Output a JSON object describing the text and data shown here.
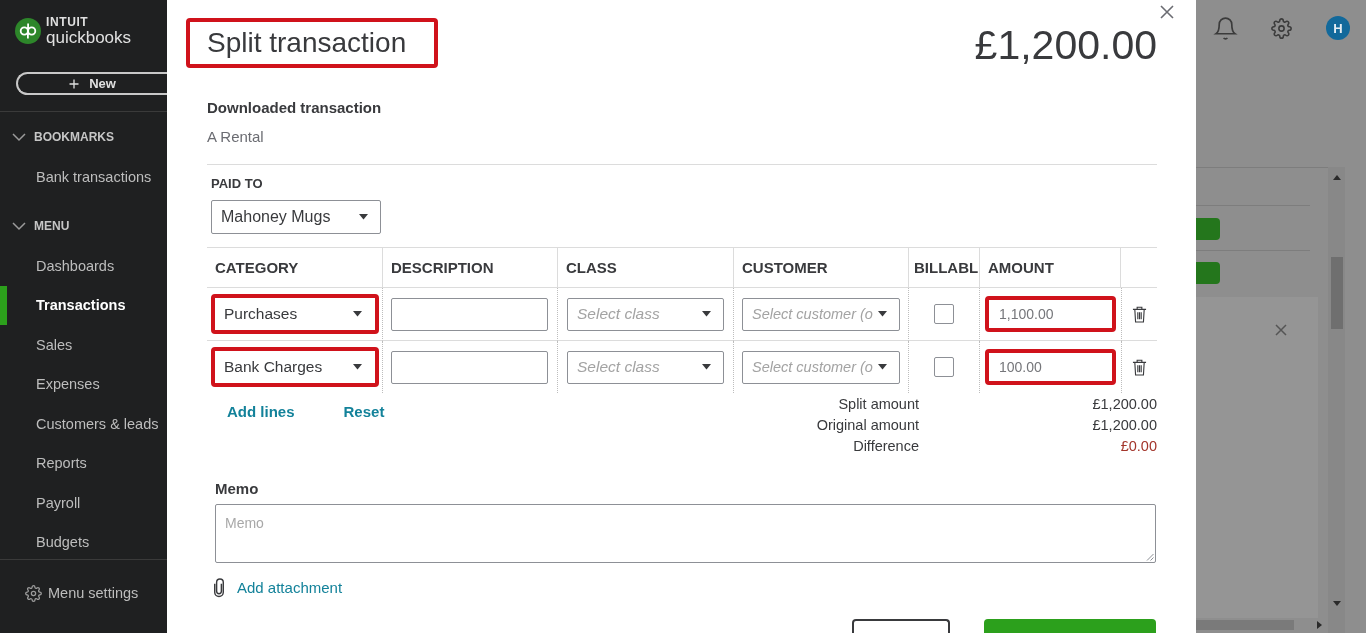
{
  "sidebar": {
    "brand": {
      "company": "INTUIT",
      "product": "quickbooks"
    },
    "new_button": "New",
    "sections": [
      {
        "title": "BOOKMARKS",
        "expanded": true,
        "items": [
          {
            "label": "Bank transactions",
            "selected": false
          }
        ]
      },
      {
        "title": "MENU",
        "expanded": true,
        "items": [
          {
            "label": "Dashboards",
            "selected": false
          },
          {
            "label": "Transactions",
            "selected": true
          },
          {
            "label": "Sales",
            "selected": false
          },
          {
            "label": "Expenses",
            "selected": false
          },
          {
            "label": "Customers & leads",
            "selected": false
          },
          {
            "label": "Reports",
            "selected": false
          },
          {
            "label": "Payroll",
            "selected": false
          },
          {
            "label": "Budgets",
            "selected": false
          }
        ]
      }
    ],
    "footer": "Menu settings"
  },
  "dialog": {
    "title": "Split transaction",
    "title_highlighted": true,
    "total": "£1,200.00",
    "downloaded_label": "Downloaded transaction",
    "downloaded_value": "A Rental",
    "paid_to": {
      "label": "PAID TO",
      "value": "Mahoney Mugs"
    },
    "table": {
      "columns": [
        "CATEGORY",
        "DESCRIPTION",
        "CLASS",
        "CUSTOMER",
        "BILLABL",
        "AMOUNT"
      ],
      "rows": [
        {
          "category": "Purchases",
          "category_highlighted": true,
          "class_placeholder": "Select class",
          "customer_placeholder": "Select customer (o",
          "billable": false,
          "amount": "1,100.00",
          "amount_highlighted": true
        },
        {
          "category": "Bank Charges",
          "category_highlighted": true,
          "class_placeholder": "Select class",
          "customer_placeholder": "Select customer (o",
          "billable": false,
          "amount": "100.00",
          "amount_highlighted": true
        }
      ]
    },
    "links": {
      "add_lines": "Add lines",
      "reset": "Reset"
    },
    "summary": [
      {
        "label": "Split amount",
        "value": "£1,200.00",
        "kind": "total"
      },
      {
        "label": "Original amount",
        "value": "£1,200.00",
        "kind": "total"
      },
      {
        "label": "Difference",
        "value": "£0.00",
        "kind": "difference"
      }
    ],
    "memo": {
      "label": "Memo",
      "placeholder": "Memo"
    },
    "attachment_link": "Add attachment",
    "buttons": [
      {
        "kind": "secondary"
      },
      {
        "kind": "primary"
      }
    ]
  },
  "background_page": {
    "avatar": "H"
  }
}
